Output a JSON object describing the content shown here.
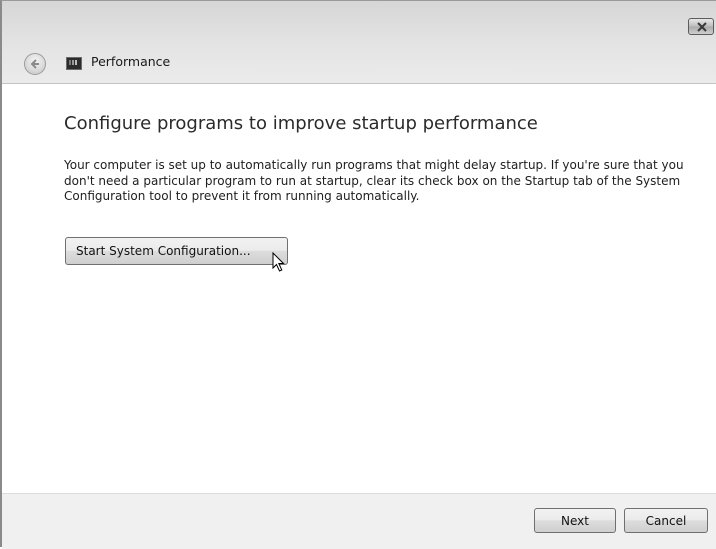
{
  "window": {
    "title": "Performance",
    "colors": {
      "title_bar": "#e4e4e4",
      "footer": "#f0f0f0",
      "button_border": "#707070"
    }
  },
  "icons": {
    "close": "close-icon",
    "back": "back-arrow-icon",
    "app": "performance-icon",
    "cursor": "mouse-cursor-icon"
  },
  "content": {
    "heading": "Configure programs to improve startup performance",
    "description": "Your computer is set up to automatically run programs that might delay startup.  If you're sure that you don't need a particular program to run at startup, clear its check box on the Startup tab of the System Configuration tool to prevent it from running automatically.",
    "start_button_label": "Start System Configuration..."
  },
  "footer": {
    "next_label": "Next",
    "cancel_label": "Cancel"
  }
}
